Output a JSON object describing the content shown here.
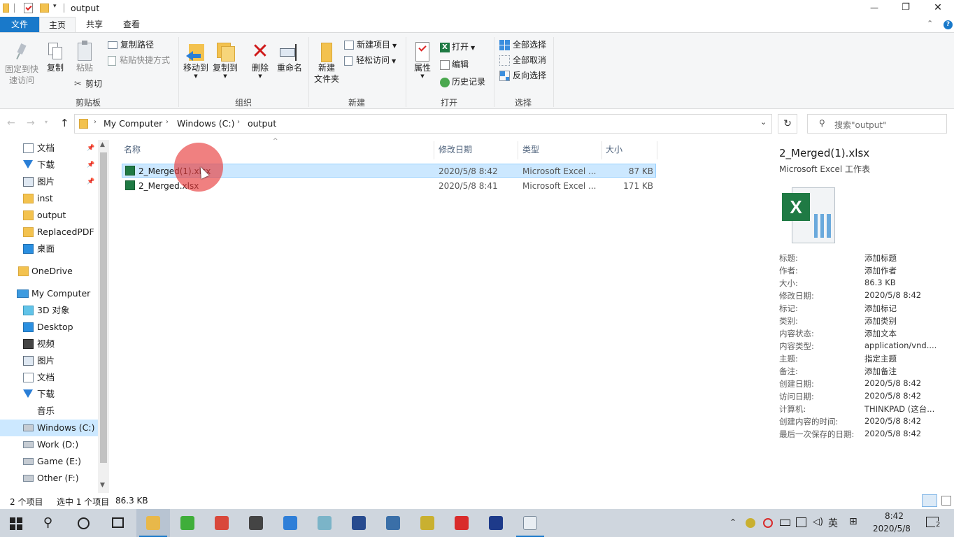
{
  "window": {
    "title": "output",
    "controls": {
      "minimize": "—",
      "maximize": "❐",
      "close": "✕"
    }
  },
  "ribbon_tabs": [
    "文件",
    "主页",
    "共享",
    "查看"
  ],
  "ribbon": {
    "clipboard": {
      "pin": "固定到快\n速访问",
      "copy": "复制",
      "paste": "粘贴",
      "copy_path": "复制路径",
      "paste_shortcut": "粘贴快捷方式",
      "cut": "剪切",
      "label": "剪贴板"
    },
    "organize": {
      "move_to": "移动到",
      "copy_to": "复制到",
      "delete": "删除",
      "rename": "重命名",
      "label": "组织"
    },
    "new": {
      "new_folder": "新建\n文件夹",
      "new_item": "新建项目",
      "easy_access": "轻松访问",
      "label": "新建"
    },
    "open": {
      "properties": "属性",
      "open": "打开",
      "edit": "编辑",
      "history": "历史记录",
      "label": "打开"
    },
    "select": {
      "select_all": "全部选择",
      "select_none": "全部取消",
      "invert": "反向选择",
      "label": "选择"
    }
  },
  "address": {
    "crumbs": [
      "My Computer",
      "Windows (C:)",
      "output"
    ],
    "search_placeholder": "搜索\"output\""
  },
  "nav": {
    "quick_access": [
      {
        "label": "文档",
        "icon": "documents-icon",
        "pinned": true
      },
      {
        "label": "下载",
        "icon": "download-icon",
        "pinned": true
      },
      {
        "label": "图片",
        "icon": "pictures-icon",
        "pinned": true
      },
      {
        "label": "inst",
        "icon": "folder-icon",
        "pinned": false
      },
      {
        "label": "output",
        "icon": "folder-icon",
        "pinned": false
      },
      {
        "label": "ReplacedPDF",
        "icon": "folder-icon",
        "pinned": false
      },
      {
        "label": "桌面",
        "icon": "desktop-icon",
        "pinned": false
      }
    ],
    "onedrive": "OneDrive",
    "computer": "My Computer",
    "computer_items": [
      {
        "label": "3D 对象",
        "icon": "3d-objects-icon"
      },
      {
        "label": "Desktop",
        "icon": "desktop-icon"
      },
      {
        "label": "视频",
        "icon": "videos-icon"
      },
      {
        "label": "图片",
        "icon": "pictures-icon"
      },
      {
        "label": "文档",
        "icon": "documents-icon"
      },
      {
        "label": "下载",
        "icon": "download-icon"
      },
      {
        "label": "音乐",
        "icon": "music-icon"
      },
      {
        "label": "Windows (C:)",
        "icon": "drive-c-icon"
      },
      {
        "label": "Work (D:)",
        "icon": "drive-icon"
      },
      {
        "label": "Game (E:)",
        "icon": "drive-icon"
      },
      {
        "label": "Other (F:)",
        "icon": "drive-icon"
      }
    ]
  },
  "columns": {
    "name": "名称",
    "modified": "修改日期",
    "type": "类型",
    "size": "大小"
  },
  "files": [
    {
      "name": "2_Merged(1).xlsx",
      "modified": "2020/5/8 8:42",
      "type": "Microsoft Excel ...",
      "size": "87 KB",
      "selected": true
    },
    {
      "name": "2_Merged.xlsx",
      "modified": "2020/5/8 8:41",
      "type": "Microsoft Excel ...",
      "size": "171 KB",
      "selected": false
    }
  ],
  "details": {
    "filename": "2_Merged(1).xlsx",
    "filetype": "Microsoft Excel 工作表",
    "props": [
      {
        "k": "标题:",
        "v": "添加标题"
      },
      {
        "k": "作者:",
        "v": "添加作者"
      },
      {
        "k": "大小:",
        "v": "86.3 KB"
      },
      {
        "k": "修改日期:",
        "v": "2020/5/8 8:42"
      },
      {
        "k": "标记:",
        "v": "添加标记"
      },
      {
        "k": "类别:",
        "v": "添加类别"
      },
      {
        "k": "内容状态:",
        "v": "添加文本"
      },
      {
        "k": "内容类型:",
        "v": "application/vnd...."
      },
      {
        "k": "主题:",
        "v": "指定主题"
      },
      {
        "k": "备注:",
        "v": "添加备注"
      },
      {
        "k": "创建日期:",
        "v": "2020/5/8 8:42"
      },
      {
        "k": "访问日期:",
        "v": "2020/5/8 8:42"
      },
      {
        "k": "计算机:",
        "v": "THINKPAD (这台..."
      },
      {
        "k": "创建内容的时间:",
        "v": "2020/5/8 8:42"
      },
      {
        "k": "最后一次保存的日期:",
        "v": "2020/5/8 8:42"
      }
    ]
  },
  "status": {
    "count": "2 个项目",
    "selected": "选中 1 个项目",
    "size": "86.3 KB"
  },
  "taskbar": {
    "time": "8:42",
    "date": "2020/5/8",
    "ime": "英",
    "notifications": "2",
    "apps": [
      {
        "icon": "file-explorer-icon",
        "color": "#e8b84a"
      },
      {
        "icon": "360-browser-icon",
        "color": "#3fae3a"
      },
      {
        "icon": "chrome-icon",
        "color": "#d9483b"
      },
      {
        "icon": "notepad-app-icon",
        "color": "#444444"
      },
      {
        "icon": "cloud-app-icon",
        "color": "#2f7fd8"
      },
      {
        "icon": "drawing-app-icon",
        "color": "#7bb4c8"
      },
      {
        "icon": "pad-gen-icon",
        "color": "#274b8f"
      },
      {
        "icon": "python-icon",
        "color": "#3a6fa8"
      },
      {
        "icon": "notes-app-icon",
        "color": "#c9b030"
      },
      {
        "icon": "red-app-icon",
        "color": "#d92b2b"
      },
      {
        "icon": "terminal-app-icon",
        "color": "#1d3a8a"
      },
      {
        "icon": "excel-file-icon",
        "color": "#e9eef3"
      }
    ]
  },
  "colors": {
    "accent": "#1979ca",
    "selection": "#cce8ff",
    "selection_border": "#99d1ff"
  }
}
